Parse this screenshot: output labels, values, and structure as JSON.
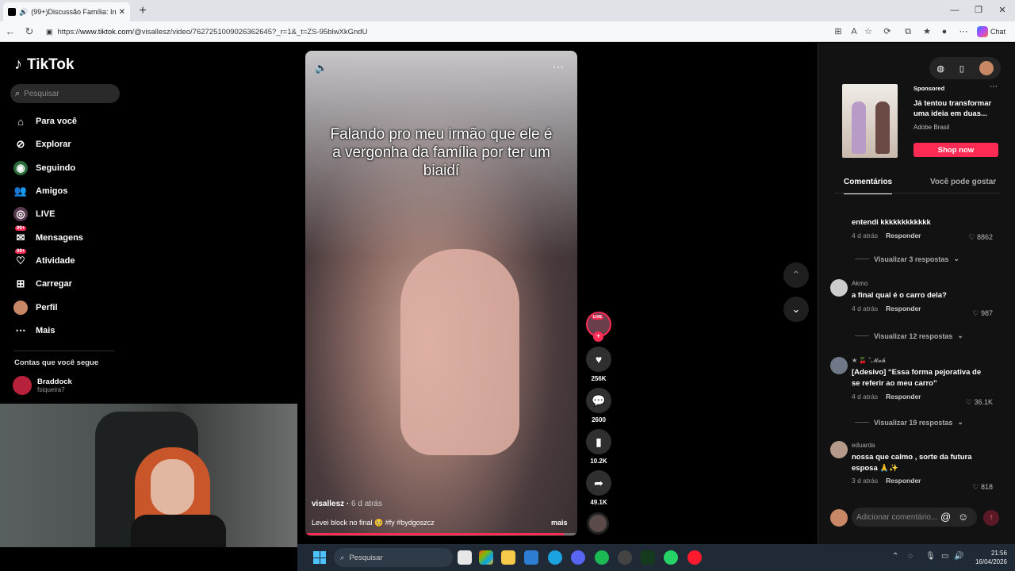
{
  "browser": {
    "tab_title": "(99+)Discussão Família: Irmão",
    "url_prefix": "https://",
    "url_host": "www.tiktok.com",
    "url_path": "/@visallesz/video/7627251009026362645?_r=1&_t=ZS-95blwXkGndU",
    "chat_label": "Chat"
  },
  "sidebar": {
    "brand": "TikTok",
    "search_placeholder": "Pesquisar",
    "items": [
      {
        "label": "Para você",
        "icon": "home-icon"
      },
      {
        "label": "Explorar",
        "icon": "compass-icon"
      },
      {
        "label": "Seguindo",
        "icon": "following-icon"
      },
      {
        "label": "Amigos",
        "icon": "friends-icon"
      },
      {
        "label": "LIVE",
        "icon": "live-icon"
      },
      {
        "label": "Mensagens",
        "icon": "messages-icon",
        "badge": "99+"
      },
      {
        "label": "Atividade",
        "icon": "activity-icon",
        "badge": "99+"
      },
      {
        "label": "Carregar",
        "icon": "upload-icon"
      },
      {
        "label": "Perfil",
        "icon": "profile-icon"
      },
      {
        "label": "Mais",
        "icon": "more-icon"
      }
    ],
    "following_title": "Contas que você segue",
    "accounts": [
      {
        "name": "Braddock",
        "handle": "fsiqueira7"
      }
    ]
  },
  "video": {
    "caption": "Falando pro meu irmão que ele é a vergonha da família por ter um biaidí",
    "author": "visallesz",
    "age": "6 d atrás",
    "description": "Levei block no final 🥺 #fy #bydgoszcz",
    "more_label": "mais",
    "progress": 0.95
  },
  "actions": {
    "live_tag": "LIVE",
    "likes": "256K",
    "comments": "2600",
    "saves": "10.2K",
    "shares": "49.1K"
  },
  "ad": {
    "sponsored_label": "Sponsored",
    "title": "Já tentou transformar uma ideia em duas...",
    "brand": "Adobe Brasil",
    "cta": "Shop now"
  },
  "right_tabs": {
    "comments": "Comentários",
    "recommend": "Você pode gostar"
  },
  "comments": [
    {
      "user": "",
      "text": "entendi kkkkkkkkkkkk",
      "time": "4 d atrás",
      "reply": "Responder",
      "likes": "8862",
      "replies": "Visualizar 3 respostas"
    },
    {
      "user": "Akmo",
      "text": "a final qual é o carro dela?",
      "time": "4 d atrás",
      "reply": "Responder",
      "likes": "987",
      "replies": "Visualizar 12 respostas"
    },
    {
      "user": "★ 🍒 ˚𝓜𝓪𝓱",
      "text": "[Adesivo] “Essa forma pejorativa de se referir ao meu carro”",
      "time": "4 d atrás",
      "reply": "Responder",
      "likes": "36.1K",
      "replies": "Visualizar 19 respostas"
    },
    {
      "user": "eduarda",
      "text": "nossa que calmo , sorte da futura esposa 🙏✨",
      "time": "3 d atrás",
      "reply": "Responder",
      "likes": "818",
      "replies": ""
    }
  ],
  "comment_input": {
    "placeholder": "Adicionar comentário..."
  },
  "taskbar": {
    "search_label": "Pesquisar",
    "time": "21:56",
    "date": "16/04/2026"
  },
  "colors": {
    "accent": "#fe2c55",
    "background": "#000000",
    "panel": "#121212"
  }
}
